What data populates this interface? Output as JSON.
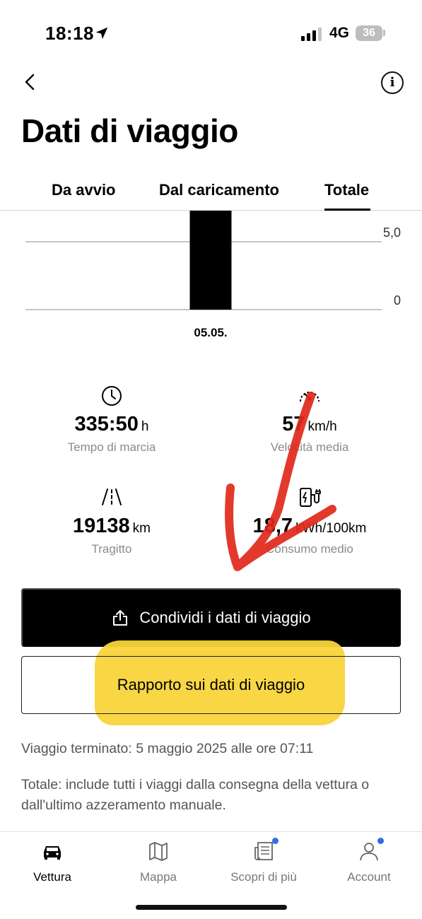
{
  "status_bar": {
    "time": "18:18",
    "network": "4G",
    "battery": "36",
    "icons": [
      "location-arrow-icon",
      "signal-icon",
      "battery-icon"
    ]
  },
  "header": {
    "back_icon": "chevron-left-icon",
    "info_icon": "info-icon",
    "info_glyph": "i",
    "title": "Dati di viaggio"
  },
  "tabs": [
    {
      "label": "Da avvio",
      "active": false
    },
    {
      "label": "Dal caricamento",
      "active": false
    },
    {
      "label": "Totale",
      "active": true
    }
  ],
  "chart_data": {
    "type": "bar",
    "categories": [
      "05.05."
    ],
    "values": [
      5.0
    ],
    "ylim": [
      0,
      5.0
    ],
    "y_ticks": [
      "5,0",
      "0"
    ],
    "grid": true,
    "bar_color": "#000000"
  },
  "stats": [
    {
      "icon": "clock-icon",
      "value": "335:50",
      "unit": "h",
      "label": "Tempo di marcia"
    },
    {
      "icon": "speedometer-icon",
      "value": "57",
      "unit": "km/h",
      "label": "Velocità media"
    },
    {
      "icon": "road-icon",
      "value": "19138",
      "unit": "km",
      "label": "Tragitto"
    },
    {
      "icon": "ev-charger-icon",
      "value": "18,7",
      "unit": "kWh/100km",
      "label": "Consumo medio"
    }
  ],
  "annotations": {
    "arrow_color": "#e0281a",
    "highlight_color": "#f8d43a"
  },
  "buttons": {
    "share_label": "Condividi i dati di viaggio",
    "share_icon": "share-icon",
    "report_label": "Rapporto sui dati di viaggio"
  },
  "info": {
    "trip_ended": "Viaggio terminato: 5 maggio 2025 alle ore 07:11",
    "note": "Totale: include tutti i viaggi dalla consegna della vettura o dall'ultimo azzeramento manuale."
  },
  "bottom_nav": [
    {
      "label": "Vettura",
      "icon": "car-icon",
      "active": true,
      "badge": false
    },
    {
      "label": "Mappa",
      "icon": "map-icon",
      "active": false,
      "badge": false
    },
    {
      "label": "Scopri di più",
      "icon": "news-icon",
      "active": false,
      "badge": true
    },
    {
      "label": "Account",
      "icon": "user-icon",
      "active": false,
      "badge": true
    }
  ],
  "colors": {
    "accent": "#000000",
    "muted_text": "#8a8a8a",
    "badge": "#2f6fdf"
  }
}
